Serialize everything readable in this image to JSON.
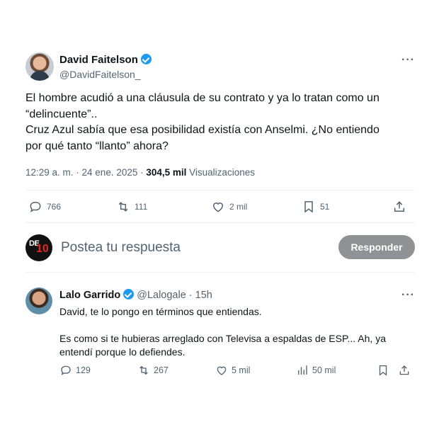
{
  "tweet": {
    "author_name": "David Faitelson",
    "author_handle": "@DavidFaitelson_",
    "text_lines": [
      "El hombre acudió a una cláusula de su contrato y ya lo tratan como un",
      "“delincuente”..",
      "Cruz Azul sabía que esa posibilidad existía con Anselmi. ¿No entiendo",
      "por qué tanto “llanto” ahora?"
    ],
    "timestamp": "12:29 a. m. · 24 ene. 2025 · ",
    "views_count": "304,5 mil",
    "views_label": " Visualizaciones",
    "more_label": "···",
    "actions": {
      "replies": "766",
      "retweets": "111",
      "likes": "2 mil",
      "bookmarks": "51"
    }
  },
  "composer": {
    "avatar_logo_text": "DE",
    "avatar_logo_number": "10",
    "placeholder": "Postea tu respuesta",
    "button_label": "Responder"
  },
  "reply": {
    "author_name": "Lalo Garrido",
    "author_handle": "@Lalogale · 15h",
    "more_label": "···",
    "text_lines": [
      "David, te lo pongo en términos que entiendas.",
      "",
      "Es como si te hubieras arreglado con Televisa a espaldas de ESP... Ah, ya",
      "entendí porque lo defiendes."
    ],
    "actions": {
      "replies": "129",
      "retweets": "267",
      "likes": "5 mil",
      "views": "50 mil"
    }
  },
  "colors": {
    "verified": "#1d9bf0",
    "secondary_text": "#536471",
    "button_bg": "#8f9194"
  }
}
